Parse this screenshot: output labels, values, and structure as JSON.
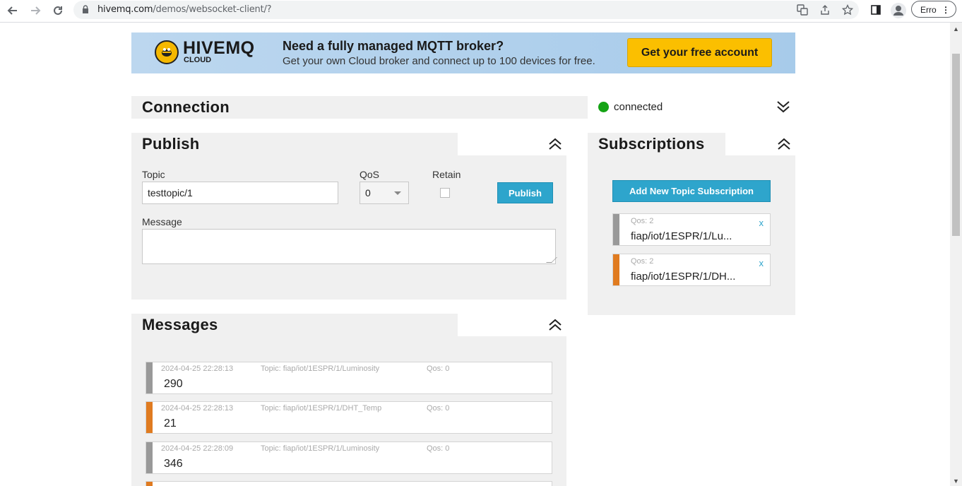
{
  "browser": {
    "url_host": "hivemq.com",
    "url_path": "/demos/websocket-client/?",
    "profile_button": "Erro"
  },
  "banner": {
    "logo_text": "HIVEMQ",
    "logo_sub": "CLOUD",
    "heading": "Need a fully managed MQTT broker?",
    "subtext": "Get your own Cloud broker and connect up to 100 devices for free.",
    "cta": "Get your free account"
  },
  "connection": {
    "title": "Connection",
    "status": "connected",
    "status_color": "#14a314"
  },
  "publish": {
    "title": "Publish",
    "topic_label": "Topic",
    "topic_value": "testtopic/1",
    "qos_label": "QoS",
    "qos_value": "0",
    "retain_label": "Retain",
    "publish_button": "Publish",
    "message_label": "Message",
    "message_value": ""
  },
  "subscriptions": {
    "title": "Subscriptions",
    "add_button": "Add New Topic Subscription",
    "items": [
      {
        "qos": "Qos: 2",
        "topic": "fiap/iot/1ESPR/1/Lu...",
        "color": "#999999",
        "remove": "x"
      },
      {
        "qos": "Qos: 2",
        "topic": "fiap/iot/1ESPR/1/DH...",
        "color": "#e07b20",
        "remove": "x"
      }
    ]
  },
  "messages": {
    "title": "Messages",
    "items": [
      {
        "time": "2024-04-25 22:28:13",
        "topic": "Topic: fiap/iot/1ESPR/1/Luminosity",
        "qos": "Qos: 0",
        "payload": "290",
        "color": "#999999"
      },
      {
        "time": "2024-04-25 22:28:13",
        "topic": "Topic: fiap/iot/1ESPR/1/DHT_Temp",
        "qos": "Qos: 0",
        "payload": "21",
        "color": "#e07b20"
      },
      {
        "time": "2024-04-25 22:28:09",
        "topic": "Topic: fiap/iot/1ESPR/1/Luminosity",
        "qos": "Qos: 0",
        "payload": "346",
        "color": "#999999"
      }
    ]
  }
}
